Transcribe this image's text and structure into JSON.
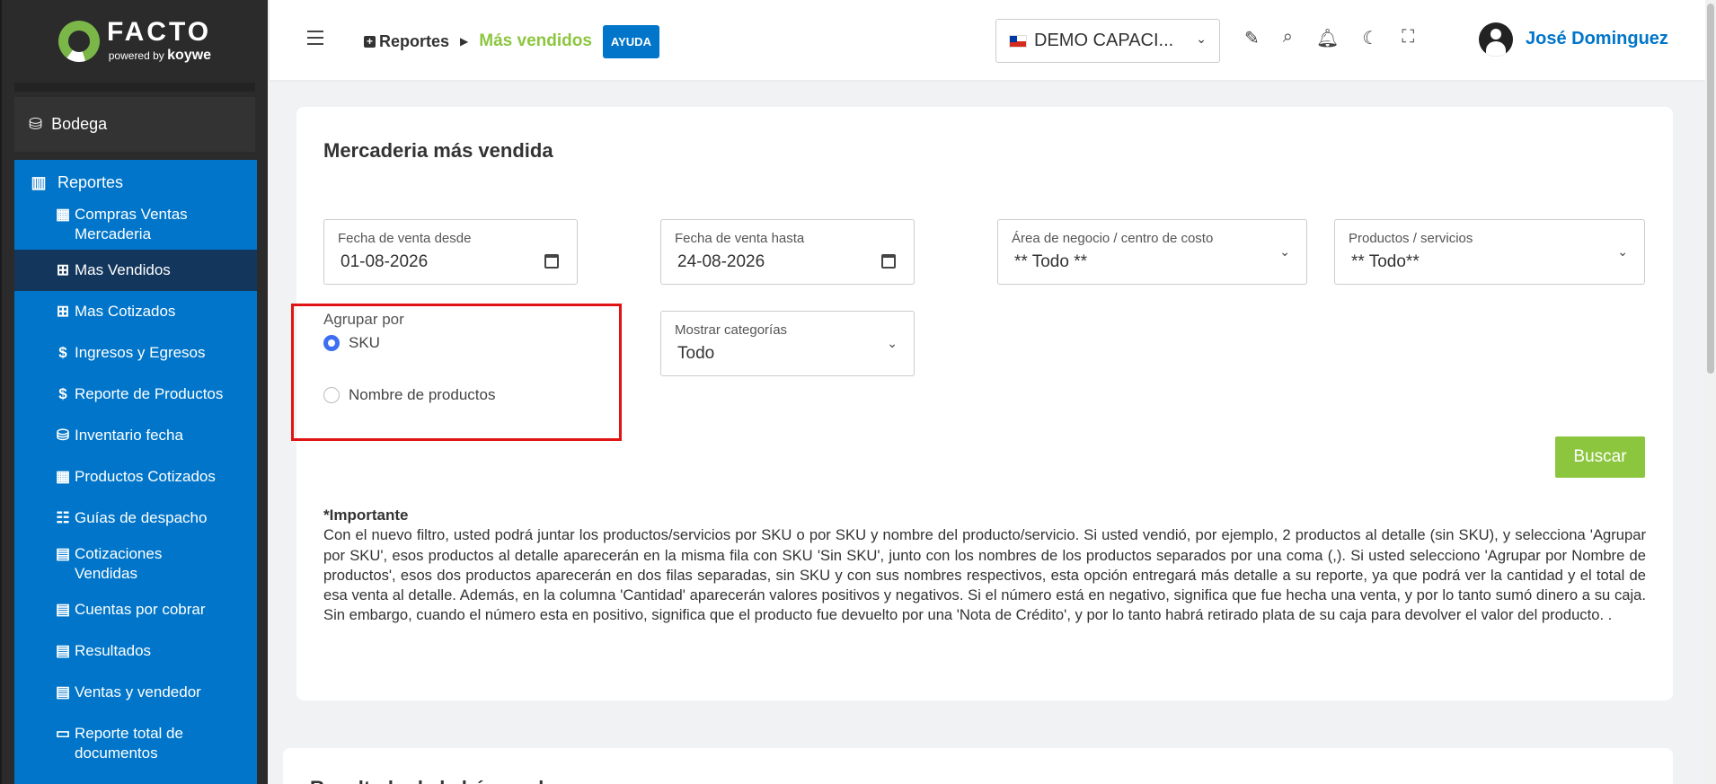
{
  "brand": {
    "name": "FACTO",
    "sub": "powered by",
    "sub_brand": "koywe"
  },
  "sidebar": {
    "bodega": "Bodega",
    "reportes": "Reportes",
    "items": [
      {
        "label": "Compras Ventas Mercaderia",
        "icon": "calculator-icon"
      },
      {
        "label": "Mas Vendidos",
        "icon": "plus-square-icon",
        "active": true
      },
      {
        "label": "Mas Cotizados",
        "icon": "plus-square-icon"
      },
      {
        "label": "Ingresos y Egresos",
        "icon": "dollar-icon"
      },
      {
        "label": "Reporte de Productos",
        "icon": "dollar-icon"
      },
      {
        "label": "Inventario fecha",
        "icon": "boxes-icon"
      },
      {
        "label": "Productos Cotizados",
        "icon": "calculator-icon"
      },
      {
        "label": "Guías de despacho",
        "icon": "table-icon"
      },
      {
        "label": "Cotizaciones Vendidas",
        "icon": "file-icon"
      },
      {
        "label": "Cuentas por cobrar",
        "icon": "file-icon"
      },
      {
        "label": "Resultados",
        "icon": "file-icon"
      },
      {
        "label": "Ventas y vendedor",
        "icon": "file-icon"
      },
      {
        "label": "Reporte total de documentos",
        "icon": "archive-icon"
      }
    ]
  },
  "header": {
    "breadcrumb_root": "Reportes",
    "breadcrumb_current": "Más vendidos",
    "help_label": "AYUDA",
    "company": "DEMO CAPACI...",
    "user": "José Dominguez"
  },
  "main": {
    "title": "Mercaderia más vendida",
    "fecha_desde": {
      "label": "Fecha de venta desde",
      "value": "01-08-2026"
    },
    "fecha_hasta": {
      "label": "Fecha de venta hasta",
      "value": "24-08-2026"
    },
    "area": {
      "label": "Área de negocio / centro de costo",
      "value": "** Todo **"
    },
    "productos": {
      "label": "Productos / servicios",
      "value": "** Todo**"
    },
    "agrupar": {
      "label": "Agrupar por",
      "opt_sku": "SKU",
      "opt_nombre": "Nombre de productos",
      "selected": "SKU"
    },
    "categorias": {
      "label": "Mostrar categorías",
      "value": "Todo"
    },
    "search_label": "Buscar",
    "important_title": "*Importante",
    "important_text": "Con el nuevo filtro, usted podrá juntar los productos/servicios por SKU o por SKU y nombre del producto/servicio. Si usted vendió, por ejemplo, 2 productos al detalle (sin SKU), y selecciona 'Agrupar por SKU', esos productos al detalle aparecerán en la misma fila con SKU 'Sin SKU', junto con los nombres de los productos separados por una coma (,). Si usted selecciono 'Agrupar por Nombre de productos', esos dos productos aparecerán en dos filas separadas, sin SKU y con sus nombres respectivos, esta opción entregará más detalle a su reporte, ya que podrá ver la cantidad y el total de esa venta al detalle. Además, en la columna 'Cantidad' aparecerán valores positivos y negativos. Si el número está en negativo, significa que fue hecha una venta, y por lo tanto sumó dinero a su caja. Sin embargo, cuando el número esta en positivo, significa que el producto fue devuelto por una 'Nota de Crédito', y por lo tanto habrá retirado plata de su caja para devolver el valor del producto. .",
    "results_title": "Resultado de la búsqueda"
  },
  "colors": {
    "accent": "#0075c9",
    "green": "#8cc63f",
    "highlight": "#e01414"
  }
}
